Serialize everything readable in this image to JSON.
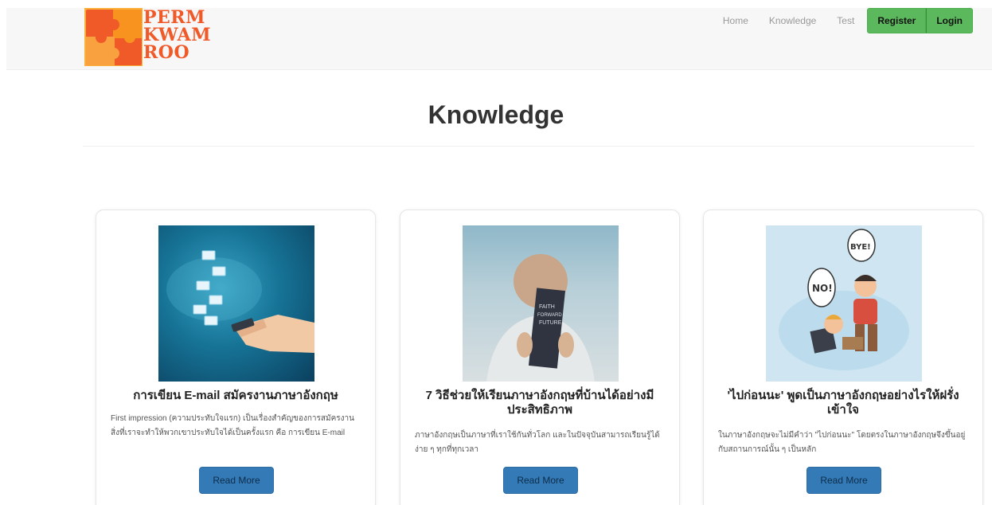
{
  "brand": {
    "lines": [
      "PERM",
      "KWAM",
      "ROO"
    ]
  },
  "nav": {
    "links": [
      "Home",
      "Knowledge",
      "Test"
    ],
    "register_label": "Register",
    "login_label": "Login"
  },
  "page": {
    "title": "Knowledge"
  },
  "cards": [
    {
      "title": "การเขียน E-mail สมัครงานภาษาอังกฤษ",
      "text": "First impression (ความประทับใจแรก) เป็นเรื่องสำคัญของการสมัครงาน สิ่งที่เราจะทำให้พวกเขาประทับใจได้เป็นครั้งแรก คือ การเขียน E-mail",
      "button": "Read More"
    },
    {
      "title": "7 วิธีช่วยให้เรียนภาษาอังกฤษที่บ้านได้อย่างมีประสิทธิภาพ",
      "text": "ภาษาอังกฤษเป็นภาษาที่เราใช้กันทั่วโลก และในปัจจุบันสามารถเรียนรู้ได้ง่าย ๆ ทุกที่ทุกเวลา",
      "button": "Read More"
    },
    {
      "title": "'ไปก่อนนะ' พูดเป็นภาษาอังกฤษอย่างไรให้ฝรั่งเข้าใจ",
      "text": "ในภาษาอังกฤษจะไม่มีคำว่า \"ไปก่อนนะ\" โดยตรงในภาษาอังกฤษจึงขึ้นอยู่กับสถานการณ์นั้น ๆ เป็นหลัก",
      "button": "Read More"
    }
  ],
  "images": {
    "book_cover": [
      "FAITH",
      "FORWARD",
      "FUTURE"
    ],
    "bubble_left": "NO!",
    "bubble_right": "BYE!"
  },
  "colors": {
    "brand": "#f05a28",
    "nav_button": "#5cb85c",
    "read_button": "#337ab7"
  }
}
